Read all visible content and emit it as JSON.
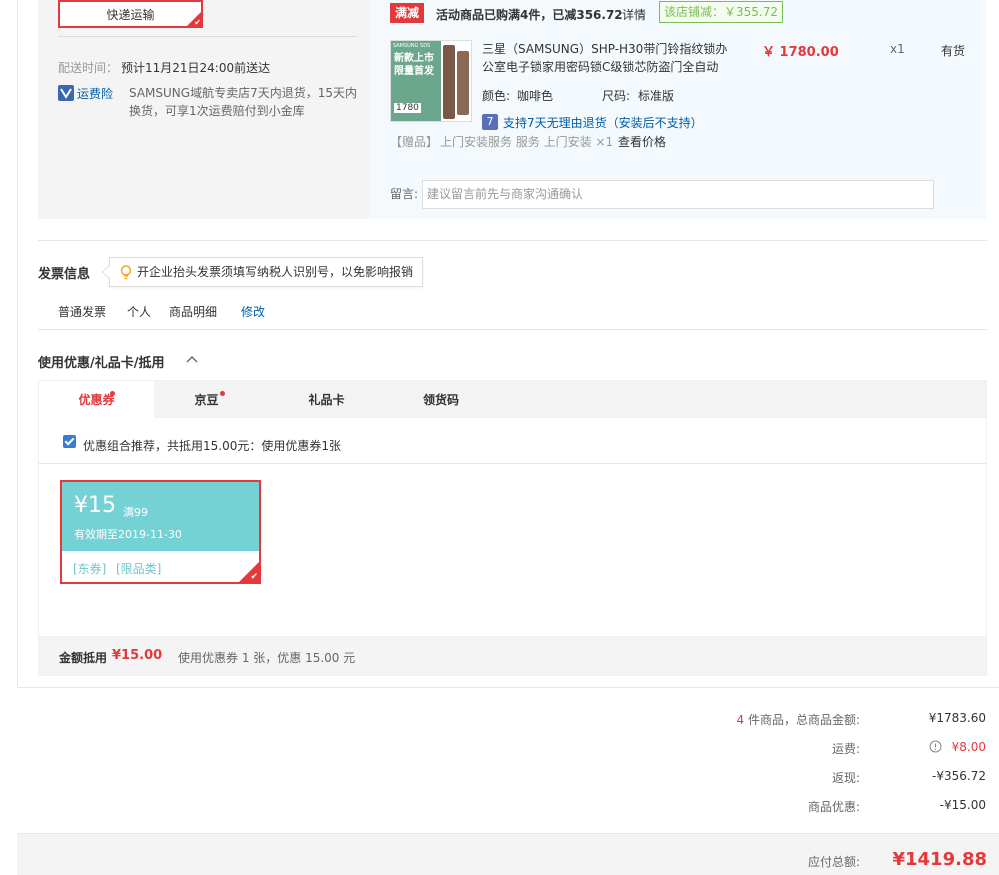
{
  "shipping": {
    "method_label": "快递运输",
    "time_label": "配送时间：",
    "time_value": "预计11月21日24:00前送达",
    "insurance_label": "运费险",
    "insurance_desc_1": "SAMSUNG域航专卖店7天内退货，15天内",
    "insurance_desc_2": "换货，可享1次运费赔付到小金库"
  },
  "promotion": {
    "tag": "满减",
    "text": "活动商品已购满4件，已减356.72",
    "detail_link": "详情",
    "shop_discount": "该店铺减：￥355.72"
  },
  "product": {
    "thumb_line1": "新款上市",
    "thumb_line2": "限量首发",
    "thumb_brand": "SAMSUNG SDS",
    "thumb_price": "1780",
    "name_line1": "三星（SAMSUNG）SHP-H30带门铃指纹锁办",
    "name_line2": "公室电子锁家用密码锁C级锁芯防盗门全自动",
    "price": "￥ 1780.00",
    "qty": "x1",
    "stock": "有货",
    "color_label": "颜色:",
    "color_value": "咖啡色",
    "size_label": "尺码:",
    "size_value": "标准版",
    "return_badge": "7",
    "return_text": "支持7天无理由退货（安装后不支持）",
    "gift_label": "【赠品】",
    "gift_text": "上门安装服务 服务 上门安装 ×1",
    "gift_link": "查看价格",
    "message_label": "留言:",
    "message_placeholder": "建议留言前先与商家沟通确认"
  },
  "invoice": {
    "title": "发票信息",
    "tip": "开企业抬头发票须填写纳税人识别号，以免影响报销",
    "type": "普通发票",
    "holder": "个人",
    "content": "商品明细",
    "edit_link": "修改"
  },
  "discount": {
    "title": "使用优惠/礼品卡/抵用",
    "tabs": [
      "优惠券",
      "京豆",
      "礼品卡",
      "领货码"
    ],
    "combo_text": "优惠组合推荐，共抵用15.00元：使用优惠券1张",
    "coupon": {
      "amount": "¥15",
      "condition": "满99",
      "valid": "有效期至2019-11-30",
      "tag1": "[东券]",
      "tag2": "[限品类]"
    },
    "summary_label": "金额抵用",
    "summary_amount": "¥15.00",
    "summary_text": "使用优惠券 1 张，优惠 15.00 元"
  },
  "totals": {
    "count": "4",
    "goods_label": " 件商品，总商品金额:",
    "goods_value": "¥1783.60",
    "shipping_label": "运费:",
    "shipping_value": "¥8.00",
    "cashback_label": "返现:",
    "cashback_value": "-¥356.72",
    "coupon_label": "商品优惠:",
    "coupon_value": "-¥15.00",
    "payable_label": "应付总额:",
    "payable_value": "¥1419.88"
  },
  "colors": {
    "accent_red": "#e4393c",
    "teal_coupon": "#74d2d4",
    "link_blue": "#005ea7",
    "green": "#7abd54"
  }
}
